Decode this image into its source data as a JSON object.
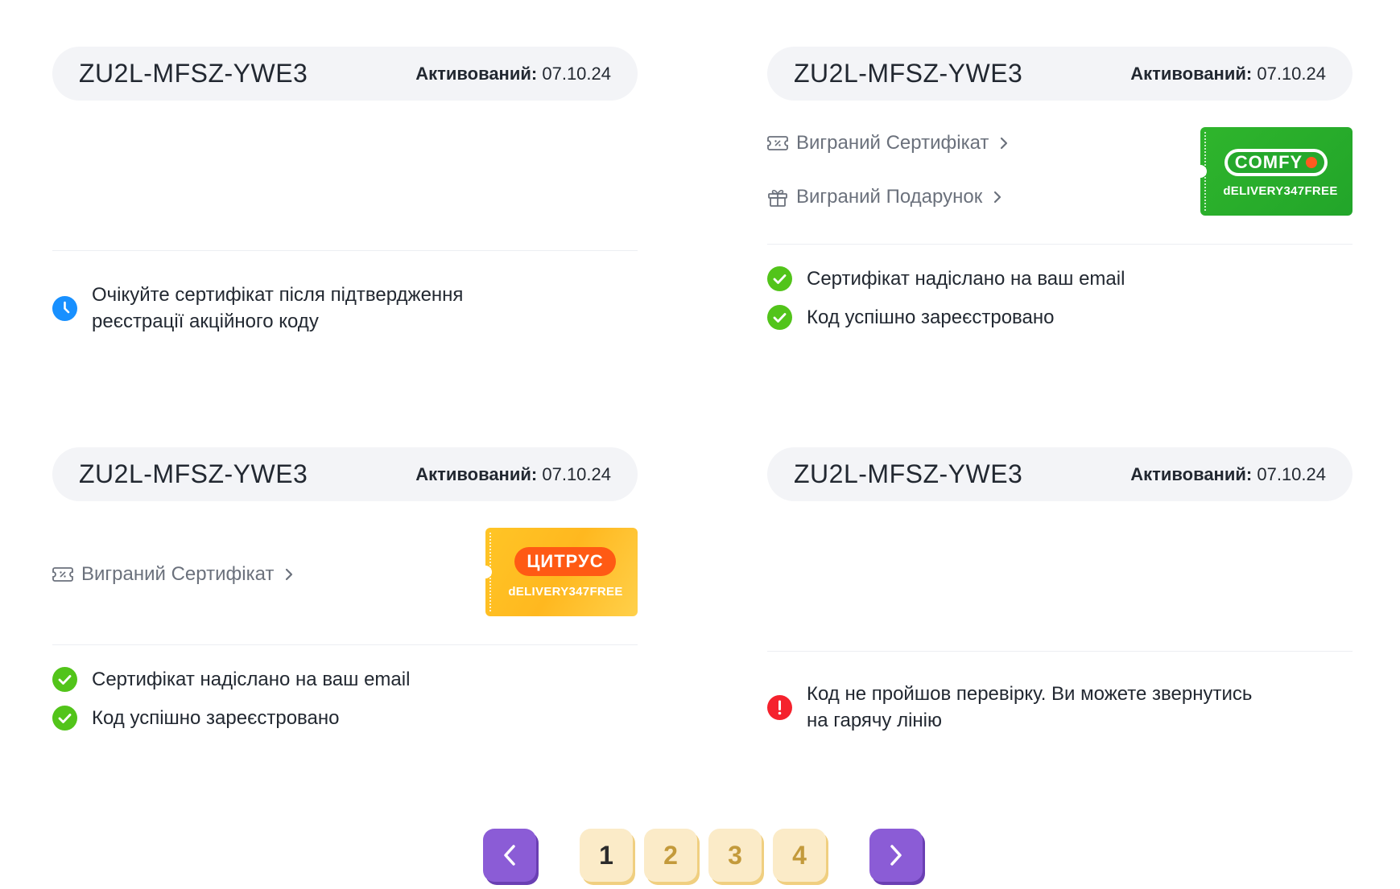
{
  "cards": [
    {
      "code": "ZU2L-MFSZ-YWE3",
      "activated_label": "Активований:",
      "activated_date": "07.10.24",
      "status_pending": "Очікуйте сертифікат після підтвердження реєстрації акційного коду"
    },
    {
      "code": "ZU2L-MFSZ-YWE3",
      "activated_label": "Активований:",
      "activated_date": "07.10.24",
      "link_certificate": "Виграний Сертифікат",
      "link_gift": "Виграний Подарунок",
      "ticket": {
        "brand": "COMFY",
        "promo_code": "dELIVERY347FREE",
        "color": "#2fb52c"
      },
      "status_email": "Сертифікат надіслано на ваш email",
      "status_registered": "Код успішно зареєстровано"
    },
    {
      "code": "ZU2L-MFSZ-YWE3",
      "activated_label": "Активований:",
      "activated_date": "07.10.24",
      "link_certificate": "Виграний Сертифікат",
      "ticket": {
        "brand": "ЦИТРУС",
        "promo_code": "dELIVERY347FREE",
        "color": "#ffc526"
      },
      "status_email": "Сертифікат надіслано на ваш email",
      "status_registered": "Код успішно зареєстровано"
    },
    {
      "code": "ZU2L-MFSZ-YWE3",
      "activated_label": "Активований:",
      "activated_date": "07.10.24",
      "status_error": "Код не пройшов перевірку. Ви можете звернутись на гарячу лінію"
    }
  ],
  "pagination": {
    "pages": [
      "1",
      "2",
      "3",
      "4"
    ],
    "current": "1",
    "prev_icon": "chevron-left-icon",
    "next_icon": "chevron-right-icon"
  },
  "colors": {
    "success": "#52c41a",
    "pending": "#1890ff",
    "error": "#f5222d",
    "nav_purple": "#8b5cd6",
    "page_cream": "#fbebc8"
  }
}
